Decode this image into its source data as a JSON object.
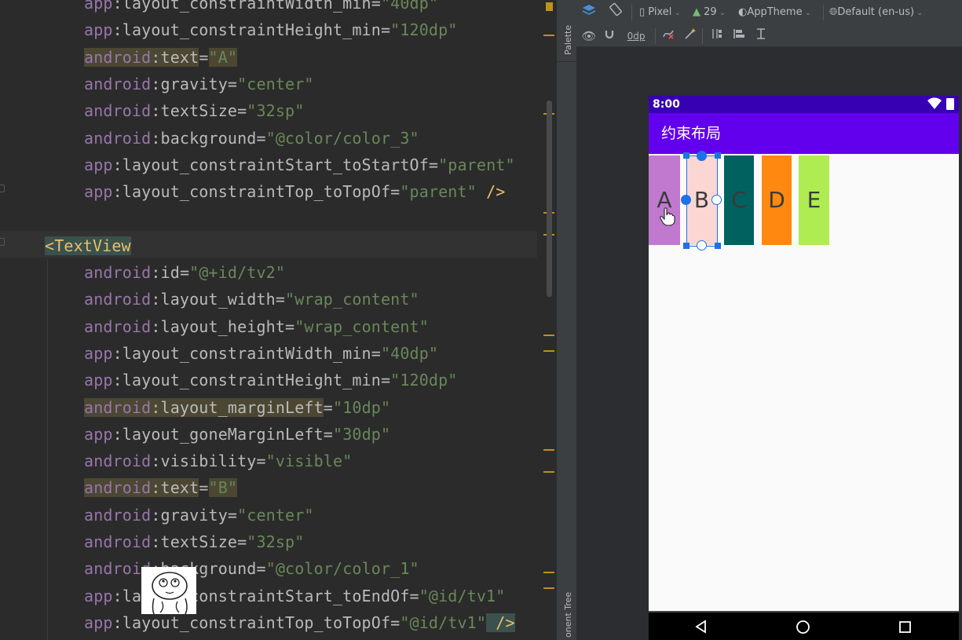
{
  "editor": {
    "lines": [
      {
        "id": "l0",
        "indent": 1,
        "ns": "app",
        "attr": "layout_constraintWidth_min",
        "val": "\"40dp\""
      },
      {
        "id": "l1",
        "indent": 1,
        "ns": "app",
        "attr": "layout_constraintHeight_min",
        "val": "\"120dp\""
      },
      {
        "id": "l2",
        "indent": 1,
        "ns": "android",
        "attr": "text",
        "val": "\"A\"",
        "hl": true
      },
      {
        "id": "l3",
        "indent": 1,
        "ns": "android",
        "attr": "gravity",
        "val": "\"center\""
      },
      {
        "id": "l4",
        "indent": 1,
        "ns": "android",
        "attr": "textSize",
        "val": "\"32sp\""
      },
      {
        "id": "l5",
        "indent": 1,
        "ns": "android",
        "attr": "background",
        "val": "\"@color/color_3\""
      },
      {
        "id": "l6",
        "indent": 1,
        "ns": "app",
        "attr": "layout_constraintStart_toStartOf",
        "val": "\"parent\""
      },
      {
        "id": "l7",
        "indent": 1,
        "ns": "app",
        "attr": "layout_constraintTop_toTopOf",
        "val": "\"parent\"",
        "close": " />"
      },
      {
        "id": "l8",
        "blank": true
      },
      {
        "id": "l9",
        "tag": "<TextView"
      },
      {
        "id": "l10",
        "indent": 1,
        "ns": "android",
        "attr": "id",
        "val": "\"@+id/tv2\""
      },
      {
        "id": "l11",
        "indent": 1,
        "ns": "android",
        "attr": "layout_width",
        "val": "\"wrap_content\""
      },
      {
        "id": "l12",
        "indent": 1,
        "ns": "android",
        "attr": "layout_height",
        "val": "\"wrap_content\""
      },
      {
        "id": "l13",
        "indent": 1,
        "ns": "app",
        "attr": "layout_constraintWidth_min",
        "val": "\"40dp\""
      },
      {
        "id": "l14",
        "indent": 1,
        "ns": "app",
        "attr": "layout_constraintHeight_min",
        "val": "\"120dp\""
      },
      {
        "id": "l15",
        "indent": 1,
        "ns": "android",
        "attr": "layout_marginLeft",
        "val": "\"10dp\"",
        "hl": true
      },
      {
        "id": "l16",
        "indent": 1,
        "ns": "app",
        "attr": "layout_goneMarginLeft",
        "val": "\"30dp\""
      },
      {
        "id": "l17",
        "indent": 1,
        "ns": "android",
        "attr": "visibility",
        "val": "\"visible\""
      },
      {
        "id": "l18",
        "indent": 1,
        "ns": "android",
        "attr": "text",
        "val": "\"B\"",
        "hl": true
      },
      {
        "id": "l19",
        "indent": 1,
        "ns": "android",
        "attr": "gravity",
        "val": "\"center\""
      },
      {
        "id": "l20",
        "indent": 1,
        "ns": "android",
        "attr": "textSize",
        "val": "\"32sp\""
      },
      {
        "id": "l21",
        "indent": 1,
        "ns": "android",
        "attr": "background",
        "val": "\"@color/color_1\""
      },
      {
        "id": "l22",
        "indent": 1,
        "ns": "app",
        "attr": "layout_constraintStart_toEndOf",
        "val": "\"@id/tv1\""
      },
      {
        "id": "l23",
        "indent": 1,
        "ns": "app",
        "attr": "layout_constraintTop_toTopOf",
        "val": "\"@id/tv1\"",
        "close": " />",
        "closeHl": true
      }
    ]
  },
  "sidebar": {
    "palette_label": "Palette",
    "component_tree_label": "onent Tree"
  },
  "toolbar": {
    "device": "Pixel",
    "api": "29",
    "theme": "AppTheme",
    "locale": "Default (en-us)",
    "margin_value": "0dp"
  },
  "phone": {
    "time": "8:00",
    "app_title": "约束布局",
    "boxes": [
      {
        "id": "a",
        "label": "A",
        "color": "#c179cf"
      },
      {
        "id": "b",
        "label": "B",
        "color": "#fcd6d3",
        "selected": true
      },
      {
        "id": "c",
        "label": "C",
        "color": "#01615f"
      },
      {
        "id": "d",
        "label": "D",
        "color": "#ff8810"
      },
      {
        "id": "e",
        "label": "E",
        "color": "#aeec52"
      }
    ]
  },
  "colors": {
    "editor_bg": "#2b2b2b",
    "status_bar": "#3700b3",
    "app_bar": "#6200ee",
    "selection": "#1a73e8"
  }
}
